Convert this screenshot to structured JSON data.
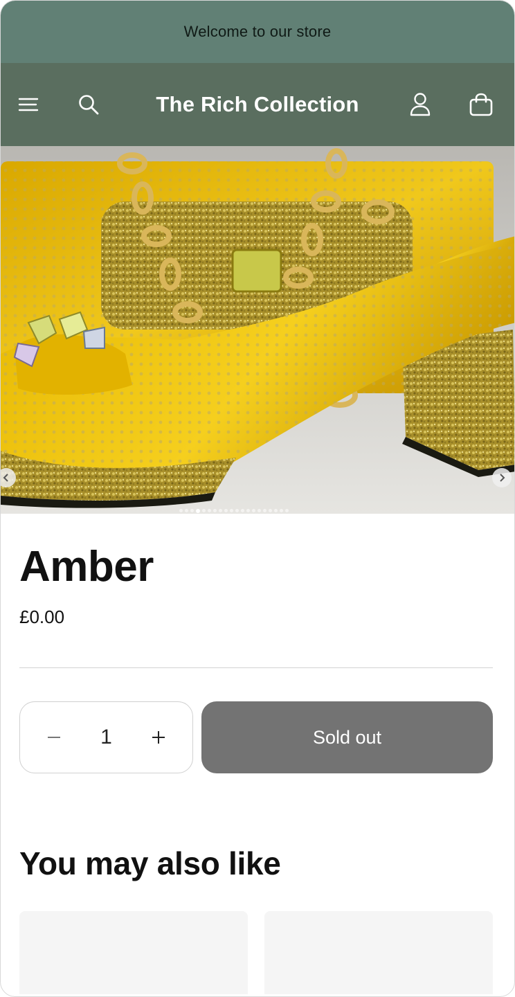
{
  "announcement": {
    "text": "Welcome to our store"
  },
  "header": {
    "brand": "The Rich Collection",
    "icons": [
      "menu-icon",
      "search-icon",
      "account-icon",
      "cart-icon"
    ]
  },
  "gallery": {
    "image": "yellow rhinestone slingback heels with matching clutch bag",
    "slide_count": 20,
    "active_slide": 4
  },
  "product": {
    "title": "Amber",
    "price": "£0.00",
    "quantity": "1",
    "sold_out_label": "Sold out"
  },
  "related": {
    "heading": "You may also like"
  },
  "colors": {
    "announcement_bg": "#618075",
    "header_bg": "#5a6e5f",
    "sold_out_bg": "#737373"
  }
}
